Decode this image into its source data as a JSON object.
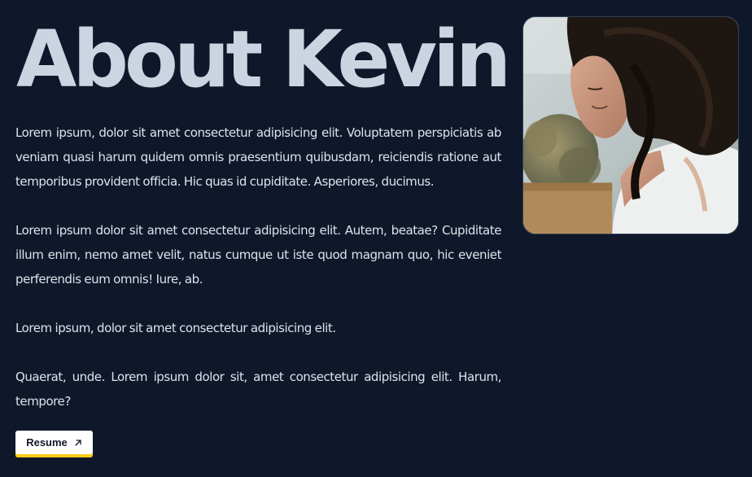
{
  "page": {
    "title": "About Kevin"
  },
  "bio": {
    "paragraphs": [
      "Lorem ipsum, dolor sit amet consectetur adipisicing elit. Voluptatem perspiciatis ab veniam quasi harum quidem omnis praesentium quibusdam, reiciendis ratione aut temporibus provident officia. Hic quas id cupiditate. Asperiores, ducimus.",
      "Lorem ipsum dolor sit amet consectetur adipisicing elit. Autem, beatae? Cupiditate illum enim, nemo amet velit, natus cumque ut iste quod magnam quo, hic eveniet perferendis eum omnis! Iure, ab.",
      "Lorem ipsum, dolor sit amet consectetur adipisicing elit.",
      "Quaerat, unde. Lorem ipsum dolor sit, amet consectetur adipisicing elit. Harum, tempore?"
    ]
  },
  "resume": {
    "label": "Resume",
    "icon": "arrow-up-right-icon"
  },
  "colors": {
    "background": "#0f172a",
    "title": "#cbd5e1",
    "text": "#dde3ec",
    "button_bg": "#ffffff",
    "button_accent": "#facc15"
  }
}
